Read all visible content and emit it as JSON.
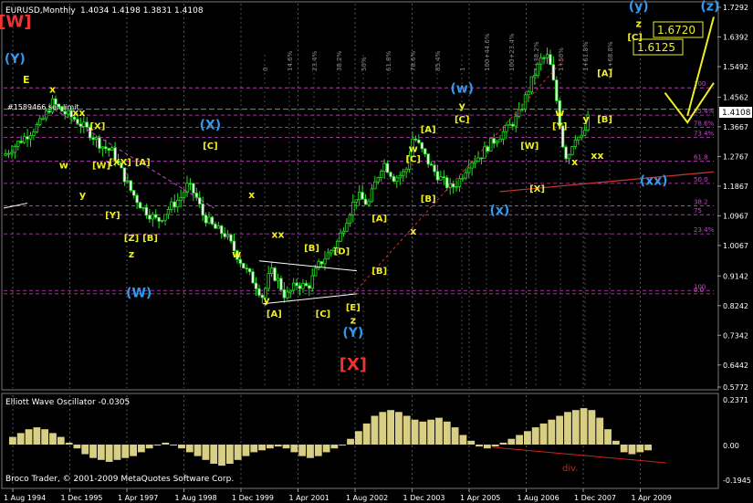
{
  "header": {
    "symbol": "EURUSD,Monthly",
    "ohlc": "1.4034 1.4198 1.3831 1.4108",
    "order": "#1589466 sell limit",
    "current_price": "1.4108"
  },
  "oscillator": {
    "title": "Elliott Wave Oscillator -0.0305",
    "axis_labels": [
      "0.2371",
      "0.00",
      "-0.1945"
    ],
    "div_label": "div.",
    "copyright": "Broco Trader, © 2001-2009 MetaQuotes Software Corp."
  },
  "chart_data": {
    "type": "candlestick",
    "title": "EURUSD,Monthly",
    "ylim": [
      0.5772,
      1.7292
    ],
    "y_ticks": [
      "1.7292",
      "1.6392",
      "1.5492",
      "1.4562",
      "1.3667",
      "1.2767",
      "1.1867",
      "1.0967",
      "1.0067",
      "0.9142",
      "0.8242",
      "0.7342",
      "0.6442",
      "0.5772"
    ],
    "x_ticks": [
      "1 Aug 1994",
      "1 Dec 1995",
      "1 Apr 1997",
      "1 Aug 1998",
      "1 Dec 1999",
      "1 Apr 2001",
      "1 Aug 2002",
      "1 Dec 2003",
      "1 Apr 2005",
      "1 Aug 2006",
      "1 Dec 2007",
      "1 Apr 2009"
    ],
    "grid": false,
    "price_path": [
      [
        1994.0,
        1.28
      ],
      [
        1994.5,
        1.33
      ],
      [
        1995.0,
        1.38
      ],
      [
        1995.3,
        1.44
      ],
      [
        1995.6,
        1.41
      ],
      [
        1995.9,
        1.39
      ],
      [
        1996.2,
        1.36
      ],
      [
        1996.6,
        1.31
      ],
      [
        1996.9,
        1.29
      ],
      [
        1997.1,
        1.24
      ],
      [
        1997.4,
        1.17
      ],
      [
        1997.7,
        1.12
      ],
      [
        1997.9,
        1.1
      ],
      [
        1998.1,
        1.08
      ],
      [
        1998.4,
        1.12
      ],
      [
        1998.7,
        1.15
      ],
      [
        1998.9,
        1.19
      ],
      [
        1999.1,
        1.16
      ],
      [
        1999.3,
        1.1
      ],
      [
        1999.6,
        1.06
      ],
      [
        1999.9,
        1.04
      ],
      [
        2000.1,
        1.0
      ],
      [
        2000.4,
        0.94
      ],
      [
        2000.7,
        0.89
      ],
      [
        2000.9,
        0.85
      ],
      [
        2001.1,
        0.93
      ],
      [
        2001.3,
        0.9
      ],
      [
        2001.5,
        0.85
      ],
      [
        2001.8,
        0.89
      ],
      [
        2002.1,
        0.88
      ],
      [
        2002.4,
        0.95
      ],
      [
        2002.7,
        0.99
      ],
      [
        2002.9,
        1.02
      ],
      [
        2003.1,
        1.08
      ],
      [
        2003.4,
        1.16
      ],
      [
        2003.7,
        1.13
      ],
      [
        2003.9,
        1.2
      ],
      [
        2004.1,
        1.26
      ],
      [
        2004.4,
        1.21
      ],
      [
        2004.7,
        1.23
      ],
      [
        2004.9,
        1.34
      ],
      [
        2005.1,
        1.3
      ],
      [
        2005.4,
        1.24
      ],
      [
        2005.7,
        1.2
      ],
      [
        2005.9,
        1.18
      ],
      [
        2006.1,
        1.2
      ],
      [
        2006.4,
        1.26
      ],
      [
        2006.7,
        1.28
      ],
      [
        2006.9,
        1.31
      ],
      [
        2007.1,
        1.33
      ],
      [
        2007.4,
        1.36
      ],
      [
        2007.7,
        1.4
      ],
      [
        2007.9,
        1.46
      ],
      [
        2008.1,
        1.52
      ],
      [
        2008.3,
        1.57
      ],
      [
        2008.5,
        1.58
      ],
      [
        2008.7,
        1.46
      ],
      [
        2008.9,
        1.3
      ],
      [
        2009.0,
        1.27
      ],
      [
        2009.2,
        1.34
      ],
      [
        2009.4,
        1.33
      ],
      [
        2009.6,
        1.41
      ]
    ],
    "oscillator_values": [
      0.04,
      0.06,
      0.08,
      0.09,
      0.08,
      0.06,
      0.04,
      0.01,
      -0.02,
      -0.05,
      -0.07,
      -0.08,
      -0.09,
      -0.08,
      -0.07,
      -0.06,
      -0.04,
      -0.02,
      0.0,
      0.01,
      0.0,
      -0.02,
      -0.04,
      -0.06,
      -0.08,
      -0.1,
      -0.11,
      -0.1,
      -0.08,
      -0.06,
      -0.04,
      -0.03,
      -0.02,
      -0.01,
      -0.02,
      -0.04,
      -0.06,
      -0.07,
      -0.06,
      -0.04,
      -0.02,
      0.0,
      0.03,
      0.07,
      0.11,
      0.15,
      0.17,
      0.18,
      0.17,
      0.15,
      0.13,
      0.12,
      0.13,
      0.14,
      0.12,
      0.09,
      0.05,
      0.02,
      -0.01,
      -0.02,
      -0.01,
      0.01,
      0.03,
      0.05,
      0.07,
      0.09,
      0.11,
      0.13,
      0.15,
      0.17,
      0.18,
      0.19,
      0.18,
      0.14,
      0.08,
      0.02,
      -0.04,
      -0.05,
      -0.04,
      -0.03
    ],
    "fib_levels": [
      {
        "label": "100",
        "price": 1.485
      },
      {
        "label": "85.4%",
        "price": 1.402
      },
      {
        "label": "78.6%",
        "price": 1.365
      },
      {
        "label": "73.4%",
        "price": 1.335
      },
      {
        "label": "61.8",
        "price": 1.262
      },
      {
        "label": "50.0",
        "price": 1.195
      },
      {
        "label": "38.2",
        "price": 1.127
      },
      {
        "label": "23.4%",
        "price": 1.042
      },
      {
        "label": "0.0",
        "price": 0.86
      },
      {
        "label": "75",
        "price": 1.1
      },
      {
        "label": "100",
        "price": 0.87
      }
    ],
    "time_labels": [
      "0",
      "14.6%",
      "23.4%",
      "38.2%",
      "50%",
      "61.8%",
      "78.6%",
      "85.4%",
      "1",
      "100+44.6%",
      "100+23.4%",
      "1+38.2%",
      "1+50%",
      "1+61.8%",
      "1+68.8%"
    ],
    "targets": [
      "1.6720",
      "1.6125"
    ],
    "wave_labels": [
      {
        "text": "[W]",
        "color": "#e33",
        "x": 1994.3,
        "y": 1.67,
        "size": 18
      },
      {
        "text": "(Y)",
        "color": "#39e",
        "x": 1994.3,
        "y": 1.56,
        "size": 14
      },
      {
        "text": "E",
        "color": "#ee2",
        "x": 1994.6,
        "y": 1.5,
        "size": 11
      },
      {
        "text": "x",
        "color": "#ee2",
        "x": 1995.3,
        "y": 1.47,
        "size": 11
      },
      {
        "text": "xx",
        "color": "#ee2",
        "x": 1996.0,
        "y": 1.4,
        "size": 11
      },
      {
        "text": "[X]",
        "color": "#ee2",
        "x": 1996.5,
        "y": 1.36,
        "size": 10
      },
      {
        "text": "w",
        "color": "#ee2",
        "x": 1995.6,
        "y": 1.24,
        "size": 11
      },
      {
        "text": "y",
        "color": "#ee2",
        "x": 1996.1,
        "y": 1.15,
        "size": 11
      },
      {
        "text": "[W]",
        "color": "#ee2",
        "x": 1996.6,
        "y": 1.24,
        "size": 10
      },
      {
        "text": "[XX]",
        "color": "#ee2",
        "x": 1997.1,
        "y": 1.25,
        "size": 10
      },
      {
        "text": "[A]",
        "color": "#ee2",
        "x": 1997.7,
        "y": 1.25,
        "size": 10
      },
      {
        "text": "[Y]",
        "color": "#ee2",
        "x": 1996.9,
        "y": 1.09,
        "size": 10
      },
      {
        "text": "[Z]",
        "color": "#ee2",
        "x": 1997.4,
        "y": 1.02,
        "size": 10
      },
      {
        "text": "[B]",
        "color": "#ee2",
        "x": 1997.9,
        "y": 1.02,
        "size": 10
      },
      {
        "text": "z",
        "color": "#ee2",
        "x": 1997.4,
        "y": 0.97,
        "size": 11
      },
      {
        "text": "(W)",
        "color": "#39e",
        "x": 1997.6,
        "y": 0.85,
        "size": 14
      },
      {
        "text": "(X)",
        "color": "#39e",
        "x": 1999.5,
        "y": 1.36,
        "size": 14
      },
      {
        "text": "[C]",
        "color": "#ee2",
        "x": 1999.5,
        "y": 1.3,
        "size": 10
      },
      {
        "text": "x",
        "color": "#ee2",
        "x": 2000.6,
        "y": 1.15,
        "size": 11
      },
      {
        "text": "w",
        "color": "#ee2",
        "x": 2000.2,
        "y": 0.97,
        "size": 11
      },
      {
        "text": "xx",
        "color": "#ee2",
        "x": 2001.3,
        "y": 1.03,
        "size": 11
      },
      {
        "text": "[B]",
        "color": "#ee2",
        "x": 2002.2,
        "y": 0.99,
        "size": 10
      },
      {
        "text": "[D]",
        "color": "#ee2",
        "x": 2003.0,
        "y": 0.98,
        "size": 10
      },
      {
        "text": "y",
        "color": "#ee2",
        "x": 2001.0,
        "y": 0.83,
        "size": 11
      },
      {
        "text": "[A]",
        "color": "#ee2",
        "x": 2001.2,
        "y": 0.79,
        "size": 10
      },
      {
        "text": "[C]",
        "color": "#ee2",
        "x": 2002.5,
        "y": 0.79,
        "size": 10
      },
      {
        "text": "[E]",
        "color": "#ee2",
        "x": 2003.3,
        "y": 0.81,
        "size": 10
      },
      {
        "text": "z",
        "color": "#ee2",
        "x": 2003.3,
        "y": 0.77,
        "size": 11
      },
      {
        "text": "(Y)",
        "color": "#39e",
        "x": 2003.3,
        "y": 0.73,
        "size": 14
      },
      {
        "text": "[X]",
        "color": "#e33",
        "x": 2003.3,
        "y": 0.63,
        "size": 18
      },
      {
        "text": "[B]",
        "color": "#ee2",
        "x": 2004.0,
        "y": 0.92,
        "size": 10
      },
      {
        "text": "[A]",
        "color": "#ee2",
        "x": 2004.0,
        "y": 1.08,
        "size": 10
      },
      {
        "text": "x",
        "color": "#ee2",
        "x": 2004.9,
        "y": 1.04,
        "size": 11
      },
      {
        "text": "w",
        "color": "#ee2",
        "x": 2004.9,
        "y": 1.29,
        "size": 11
      },
      {
        "text": "[C]",
        "color": "#ee2",
        "x": 2004.9,
        "y": 1.26,
        "size": 10
      },
      {
        "text": "[B]",
        "color": "#ee2",
        "x": 2005.3,
        "y": 1.14,
        "size": 10
      },
      {
        "text": "[A]",
        "color": "#ee2",
        "x": 2005.3,
        "y": 1.35,
        "size": 10
      },
      {
        "text": "(w)",
        "color": "#39e",
        "x": 2006.2,
        "y": 1.47,
        "size": 14
      },
      {
        "text": "y",
        "color": "#ee2",
        "x": 2006.2,
        "y": 1.42,
        "size": 11
      },
      {
        "text": "[C]",
        "color": "#ee2",
        "x": 2006.2,
        "y": 1.38,
        "size": 10
      },
      {
        "text": "(x)",
        "color": "#39e",
        "x": 2007.2,
        "y": 1.1,
        "size": 14
      },
      {
        "text": "[X]",
        "color": "#ee2",
        "x": 2008.2,
        "y": 1.17,
        "size": 10
      },
      {
        "text": "[W]",
        "color": "#ee2",
        "x": 2008.0,
        "y": 1.3,
        "size": 10
      },
      {
        "text": "w",
        "color": "#ee2",
        "x": 2008.8,
        "y": 1.4,
        "size": 11
      },
      {
        "text": "[Y]",
        "color": "#ee2",
        "x": 2008.8,
        "y": 1.36,
        "size": 10
      },
      {
        "text": "y",
        "color": "#ee2",
        "x": 2009.5,
        "y": 1.38,
        "size": 11
      },
      {
        "text": "xx",
        "color": "#ee2",
        "x": 2009.8,
        "y": 1.27,
        "size": 11
      },
      {
        "text": "x",
        "color": "#ee2",
        "x": 2009.2,
        "y": 1.25,
        "size": 11
      },
      {
        "text": "[A]",
        "color": "#ee2",
        "x": 2010.0,
        "y": 1.52,
        "size": 10
      },
      {
        "text": "[B]",
        "color": "#ee2",
        "x": 2010.0,
        "y": 1.38,
        "size": 10
      },
      {
        "text": "z",
        "color": "#ee2",
        "x": 2010.9,
        "y": 1.67,
        "size": 11
      },
      {
        "text": "[C]",
        "color": "#ee2",
        "x": 2010.8,
        "y": 1.63,
        "size": 10
      },
      {
        "text": "(y)",
        "color": "#39e",
        "x": 2010.9,
        "y": 1.72,
        "size": 14
      },
      {
        "text": "(xx)",
        "color": "#39e",
        "x": 2011.3,
        "y": 1.19,
        "size": 14
      },
      {
        "text": "(z)",
        "color": "#39e",
        "x": 2012.8,
        "y": 1.72,
        "size": 14
      }
    ]
  }
}
